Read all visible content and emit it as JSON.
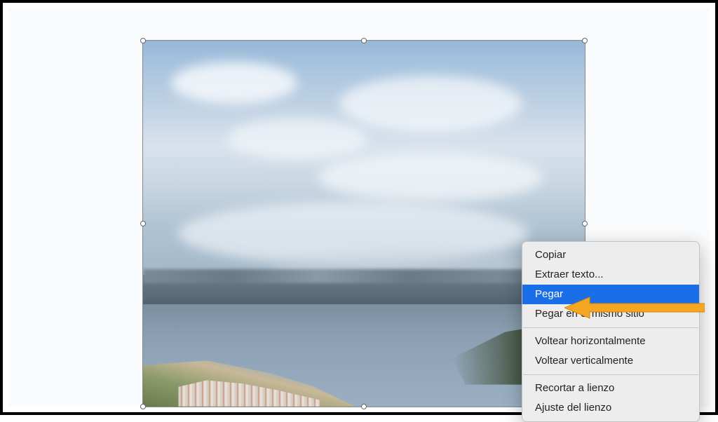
{
  "context_menu": {
    "items": [
      {
        "label": "Copiar",
        "highlighted": false
      },
      {
        "label": "Extraer texto...",
        "highlighted": false
      },
      {
        "label": "Pegar",
        "highlighted": true
      },
      {
        "label": "Pegar en el mismo sitio",
        "highlighted": false
      }
    ],
    "group2": [
      {
        "label": "Voltear horizontalmente"
      },
      {
        "label": "Voltear verticalmente"
      }
    ],
    "group3": [
      {
        "label": "Recortar a lienzo"
      },
      {
        "label": "Ajuste del lienzo"
      }
    ]
  },
  "colors": {
    "menu_highlight": "#1a6fe8",
    "arrow": "#f5a623"
  }
}
